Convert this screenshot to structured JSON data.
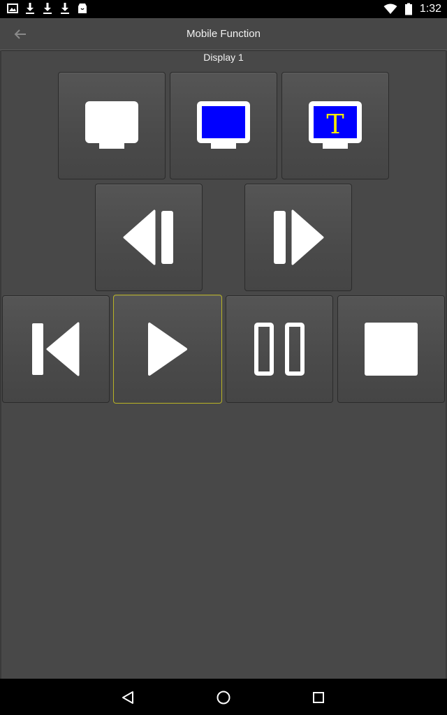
{
  "status_bar": {
    "time": "1:32",
    "left_icons": [
      "image-icon",
      "download-icon",
      "download-icon",
      "download-icon",
      "store-icon"
    ],
    "right_icons": [
      "wifi-icon",
      "battery-icon"
    ]
  },
  "action_bar": {
    "title": "Mobile Function",
    "back_icon": "arrow-left-icon"
  },
  "display": {
    "label": "Display 1"
  },
  "buttons": {
    "row1": [
      "display-white-icon",
      "display-blue-icon",
      "display-text-icon"
    ],
    "row2": [
      "previous-icon",
      "next-icon"
    ],
    "row3": [
      "skip-to-start-icon",
      "play-icon",
      "pause-icon",
      "stop-icon"
    ],
    "focused": "play-button"
  },
  "display_text_glyph": "T",
  "colors": {
    "background": "#484848",
    "blue_screen": "#0000ff",
    "text_glyph": "#f5e800",
    "focus_border": "#b9b325"
  },
  "nav_bar": {
    "icons": [
      "back-triangle-icon",
      "home-circle-icon",
      "recents-square-icon"
    ]
  }
}
